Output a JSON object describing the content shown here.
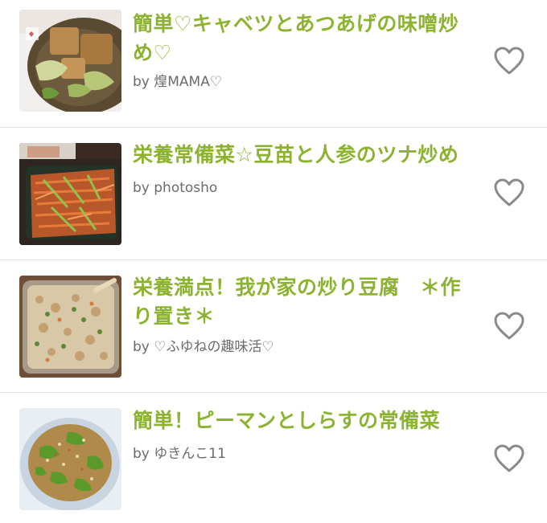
{
  "recipes": [
    {
      "title": "簡単♡キャベツとあつあげの味噌炒め♡",
      "author": "by 煌MAMA♡",
      "thumb_icon": "fried-tofu-cabbage-photo"
    },
    {
      "title": "栄養常備菜☆豆苗と人参のツナ炒め",
      "author": "by photosho",
      "thumb_icon": "carrot-pea-shoot-salad-photo"
    },
    {
      "title": "栄養満点！我が家の炒り豆腐　＊作り置き＊",
      "author": "by ♡ふゆねの趣味活♡",
      "thumb_icon": "scrambled-tofu-container-photo"
    },
    {
      "title": "簡単！ピーマンとしらすの常備菜",
      "author": "by ゆきんこ11",
      "thumb_icon": "green-pepper-shirasu-photo"
    }
  ],
  "icons": {
    "favorite": "heart-outline-icon"
  },
  "colors": {
    "title": "#8cb32f",
    "author": "#6b6b6b",
    "heart": "#8a8a8a",
    "divider": "#e3e3e3"
  }
}
